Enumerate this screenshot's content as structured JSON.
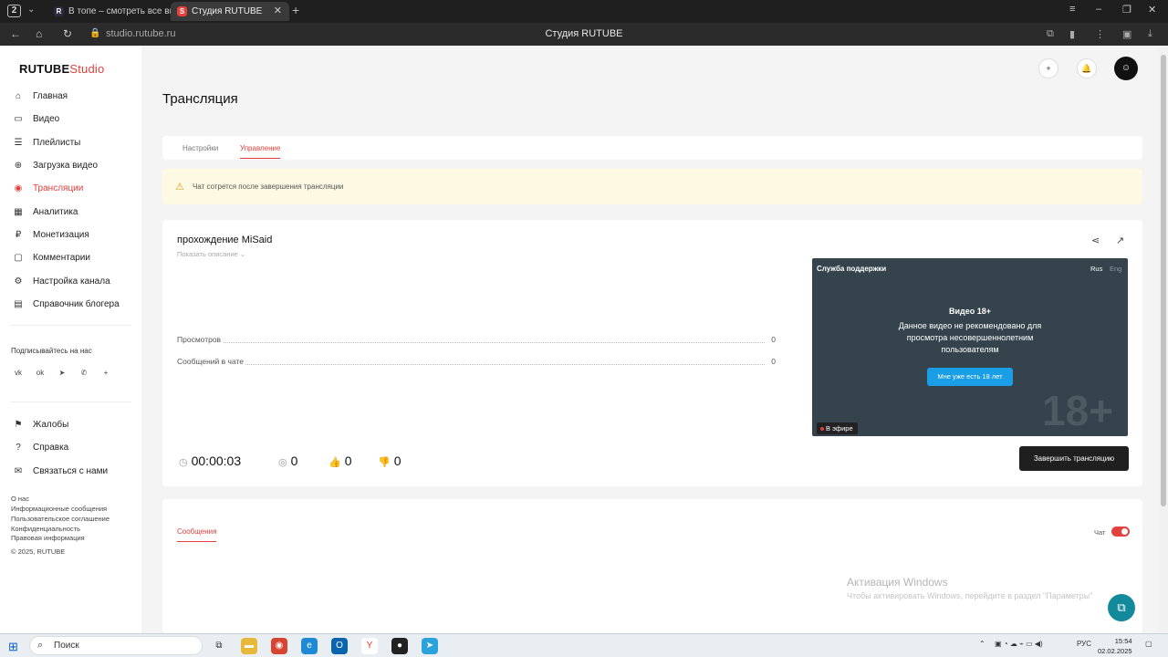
{
  "browser": {
    "tab_counter": "2",
    "tabs": [
      {
        "label": "В топе – смотреть все ви",
        "favicon": "R",
        "active": false
      },
      {
        "label": "Студия RUTUBE",
        "favicon": "S",
        "active": true
      }
    ],
    "url": "studio.rutube.ru",
    "page_title": "Студия RUTUBE"
  },
  "logo": {
    "brand": "RUTUBE",
    "suffix": "Studio"
  },
  "sidebar": {
    "items": [
      {
        "label": "Главная",
        "icon": "home-icon"
      },
      {
        "label": "Видео",
        "icon": "video-icon"
      },
      {
        "label": "Плейлисты",
        "icon": "playlist-icon"
      },
      {
        "label": "Загрузка видео",
        "icon": "upload-icon"
      },
      {
        "label": "Трансляции",
        "icon": "broadcast-icon",
        "active": true
      },
      {
        "label": "Аналитика",
        "icon": "analytics-icon"
      },
      {
        "label": "Монетизация",
        "icon": "monetization-icon"
      },
      {
        "label": "Комментарии",
        "icon": "comments-icon"
      },
      {
        "label": "Настройка канала",
        "icon": "settings-icon"
      },
      {
        "label": "Справочник блогера",
        "icon": "book-icon"
      }
    ],
    "subscribe_label": "Подписывайтесь на нас",
    "social": [
      "vk",
      "ok",
      "telegram",
      "viber",
      "+"
    ],
    "support_items": [
      {
        "label": "Жалобы",
        "icon": "flag-icon"
      },
      {
        "label": "Справка",
        "icon": "help-icon"
      },
      {
        "label": "Связаться с нами",
        "icon": "mail-icon"
      }
    ],
    "footer_links": [
      "О нас",
      "Информационные сообщения",
      "Пользовательское соглашение",
      "Конфиденциальность",
      "Правовая информация"
    ],
    "copyright": "© 2025, RUTUBE"
  },
  "page": {
    "title": "Трансляция",
    "tabs": [
      "Настройки",
      "Управление"
    ],
    "active_tab": "Управление",
    "warning": "Чат сотрется после завершения трансляции"
  },
  "stream": {
    "title": "прохождение MiSaid",
    "show_description": "Показать описание ⌄",
    "stats": [
      {
        "label": "Просмотров",
        "value": "0"
      },
      {
        "label": "Сообщений в чате",
        "value": "0"
      }
    ],
    "duration": "00:00:03",
    "viewers": "0",
    "likes": "0",
    "dislikes": "0",
    "end_button": "Завершить трансляцию"
  },
  "player": {
    "support": "Служба поддержки",
    "lang_ru": "Rus",
    "lang_en": "Eng",
    "age_title": "Видео 18+",
    "age_text": "Данное видео не рекомендовано для просмотра несовершеннолетним пользователям",
    "confirm_button": "Мне уже есть 18 лет",
    "age_badge": "18+",
    "live_label": "В эфире"
  },
  "chat": {
    "tab_label": "Сообщения",
    "toggle_label": "Чат",
    "enabled": true
  },
  "watermark": {
    "title": "Активация Windows",
    "text": "Чтобы активировать Windows, перейдите в раздел \"Параметры\""
  },
  "taskbar": {
    "search": "Поиск",
    "lang": "РУС",
    "time": "15:54",
    "date": "02.02.2025"
  },
  "colors": {
    "accent": "#e3413d",
    "player_bg": "#34434c",
    "confirm": "#1a9ee6"
  }
}
